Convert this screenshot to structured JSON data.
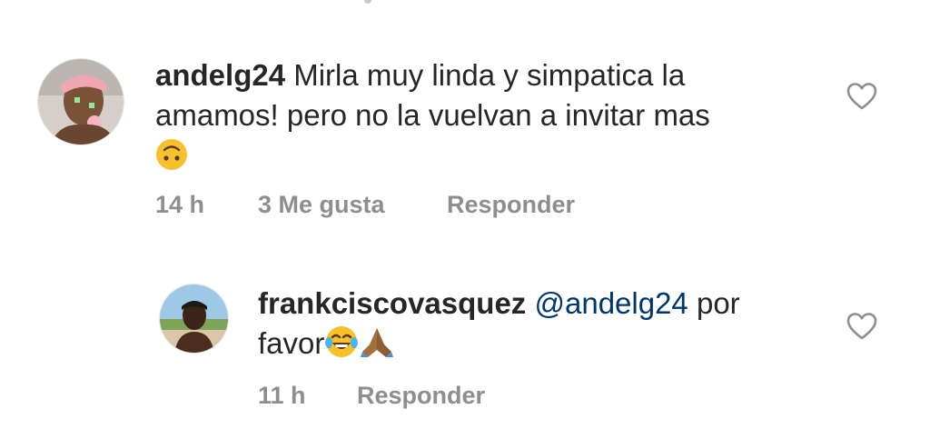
{
  "comments": [
    {
      "username": "andelg24",
      "text_line1": "Mirla muy linda y simpatica la",
      "text_line2": "amamos! pero no la vuelvan a invitar mas",
      "emoji": "upside-down-face-emoji",
      "time": "14 h",
      "likes": "3 Me gusta",
      "reply_label": "Responder",
      "like_icon": "heart-outline-icon"
    },
    {
      "username": "frankciscovasquez",
      "mention": "@andelg24",
      "text_after_mention": " por",
      "text_line2": "favor",
      "emojis": [
        "face-with-tears-of-joy-emoji",
        "folded-hands-emoji"
      ],
      "time": "11 h",
      "reply_label": "Responder",
      "like_icon": "heart-outline-icon"
    }
  ],
  "colors": {
    "text": "#262626",
    "meta": "#8e8e8e",
    "mention": "#00376b",
    "emoji_yellow": "#f7c02f",
    "hands": "#a0703f"
  }
}
